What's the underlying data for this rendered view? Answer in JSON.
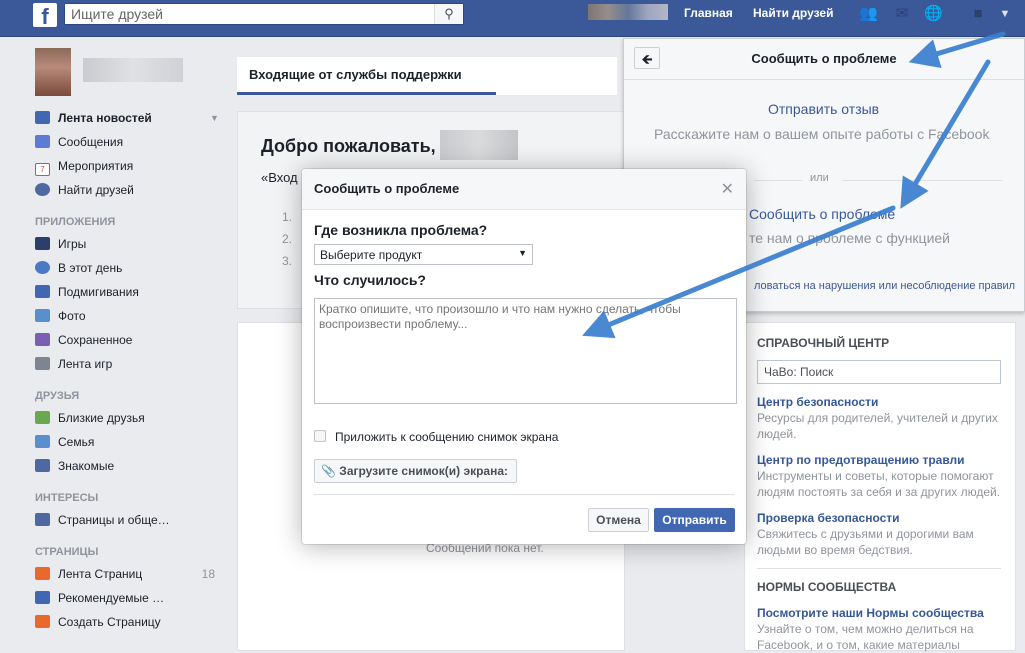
{
  "topbar": {
    "logo": "f",
    "search_placeholder": "Ищите друзей",
    "nav": [
      "Главная",
      "Найти друзей"
    ]
  },
  "sidebar": {
    "items": [
      {
        "label": "Лента новостей",
        "icon": "news-feed-icon",
        "color": "#4267b2"
      },
      {
        "label": "Сообщения",
        "icon": "messages-icon",
        "color": "#5b7bd5"
      },
      {
        "label": "Мероприятия",
        "icon": "calendar-icon",
        "color": "#d14f4f",
        "badge": "7"
      },
      {
        "label": "Найти друзей",
        "icon": "find-friends-icon",
        "color": "#4e69a2"
      }
    ],
    "apps_head": "ПРИЛОЖЕНИЯ",
    "apps": [
      {
        "label": "Игры",
        "icon": "games-icon",
        "color": "#2c3e6a"
      },
      {
        "label": "В этот день",
        "icon": "on-this-day-icon",
        "color": "#4d78c4"
      },
      {
        "label": "Подмигивания",
        "icon": "pokes-icon",
        "color": "#4267b2"
      },
      {
        "label": "Фото",
        "icon": "photos-icon",
        "color": "#5a8fce"
      },
      {
        "label": "Сохраненное",
        "icon": "saved-icon",
        "color": "#7b5fb0"
      },
      {
        "label": "Лента игр",
        "icon": "games-feed-icon",
        "color": "#7d8591"
      }
    ],
    "friends_head": "ДРУЗЬЯ",
    "friends": [
      {
        "label": "Близкие друзья",
        "icon": "close-friends-icon",
        "color": "#6aa84f"
      },
      {
        "label": "Семья",
        "icon": "family-icon",
        "color": "#5a8fce"
      },
      {
        "label": "Знакомые",
        "icon": "acquaintances-icon",
        "color": "#4e69a2"
      }
    ],
    "interests_head": "ИНТЕРЕСЫ",
    "interests": [
      {
        "label": "Страницы и обще…",
        "icon": "pages-feed-icon",
        "color": "#4e69a2"
      }
    ],
    "pages_head": "СТРАНИЦЫ",
    "pages": [
      {
        "label": "Лента Страниц",
        "icon": "pages-flag-icon",
        "color": "#e9692c",
        "count": "18"
      },
      {
        "label": "Рекомендуемые …",
        "icon": "recommended-icon",
        "color": "#4267b2"
      },
      {
        "label": "Создать Страницу",
        "icon": "create-page-icon",
        "color": "#e9692c"
      }
    ]
  },
  "center": {
    "tab": "Входящие от службы поддержки",
    "welcome_title": "Добро пожаловать,",
    "welcome_quote": "«Вход",
    "welcome_nums": [
      "1.",
      "2.",
      "3."
    ],
    "no_messages": "Сообщений пока нет."
  },
  "report_panel": {
    "title": "Сообщить о проблеме",
    "feedback_link": "Отправить отзыв",
    "feedback_desc": "Расскажите нам о вашем опыте работы с Facebook",
    "or": "или",
    "report_link": "Сообщить о проблеме",
    "report_desc": "те нам о проблеме с функцией",
    "abuse_link": "ловаться на нарушения или несоблюдение правил"
  },
  "help": {
    "head": "СПРАВОЧНЫЙ ЦЕНТР",
    "search_value": "ЧаВо: Поиск",
    "links": [
      {
        "title": "Центр безопасности",
        "desc": "Ресурсы для родителей, учителей и других людей."
      },
      {
        "title": "Центр по предотвращению травли",
        "desc": "Инструменты и советы, которые помогают людям постоять за себя и за других людей."
      },
      {
        "title": "Проверка безопасности",
        "desc": "Свяжитесь с друзьями и дорогими вам людьми во время бедствия."
      }
    ],
    "norms_head": "НОРМЫ СООБЩЕСТВА",
    "norms_link": "Посмотрите наши Нормы сообщества",
    "norms_desc": "Узнайте о том, чем можно делиться на Facebook, и о том, какие материалы"
  },
  "modal": {
    "title": "Сообщить о проблеме",
    "where_label": "Где возникла проблема?",
    "select_value": "Выберите продукт",
    "what_label": "Что случилось?",
    "textarea_placeholder": "Кратко опишите, что произошло и что нам нужно сделать, чтобы воспроизвести проблему...",
    "screenshot_checkbox": "Приложить к сообщению снимок экрана",
    "upload_button": "Загрузите снимок(и) экрана:",
    "cancel_button": "Отмена",
    "send_button": "Отправить"
  },
  "colors": {
    "brand": "#3b5998",
    "primary_button": "#4267b2",
    "annotation_arrow": "#3a7fcf"
  }
}
